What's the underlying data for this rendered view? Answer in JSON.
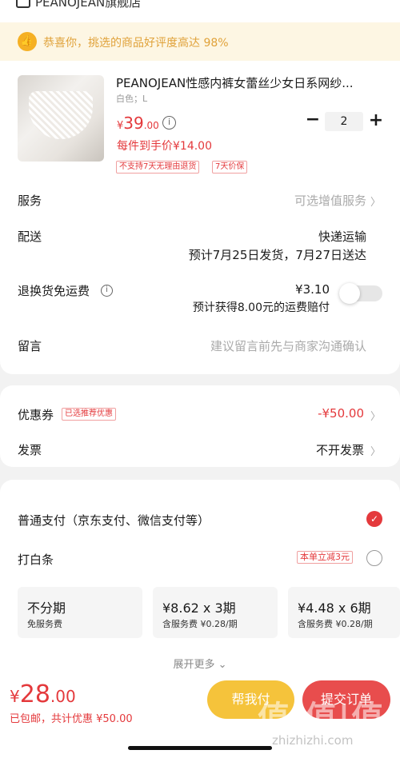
{
  "store": {
    "name": "PEANOJEAN旗舰店",
    "icon": "store-icon"
  },
  "notice": {
    "text": "恭喜你，挑选的商品好评度高达 98%",
    "icon": "thumbs-up-icon"
  },
  "product": {
    "name": "PEANOJEAN性感内裤女蕾丝少女日系网纱...",
    "spec": "白色；L",
    "price_currency": "¥",
    "price_int": "39",
    "price_dec": ".00",
    "unit_price": "每件到手价¥14.00",
    "tags": [
      "不支持7天无理由退货",
      "7天价保"
    ],
    "quantity": "2",
    "minus": "−",
    "plus": "+"
  },
  "service": {
    "label": "服务",
    "value": "可选增值服务",
    "chevron": "〉"
  },
  "delivery": {
    "label": "配送",
    "method": "快递运输",
    "schedule": "预计7月25日发货，7月27日送达"
  },
  "return_shipping": {
    "label": "退换货免运费",
    "price": "¥3.10",
    "note": "预计获得8.00元的运费赔付",
    "enabled": false
  },
  "message": {
    "label": "留言",
    "placeholder": "建议留言前先与商家沟通确认"
  },
  "coupon": {
    "label": "优惠券",
    "tag": "已选推荐优惠",
    "value": "-¥50.00",
    "chevron": "〉"
  },
  "invoice": {
    "label": "发票",
    "value": "不开发票",
    "chevron": "〉"
  },
  "payment": {
    "normal_label": "普通支付（京东支付、微信支付等）",
    "normal_selected": true,
    "baitiao_label": "打白条",
    "baitiao_tag": "本单立减3元",
    "plans": [
      {
        "title": "不分期",
        "sub": "免服务费"
      },
      {
        "title": "¥8.62 x 3期",
        "sub": "含服务费 ¥0.28/期"
      },
      {
        "title": "¥4.48 x 6期",
        "sub": "含服务费 ¥0.28/期"
      }
    ],
    "more": "展开更多 ⌄"
  },
  "footer": {
    "currency": "¥",
    "total_int": "28",
    "total_dec": ".00",
    "sub": "已包邮，共计优惠 ¥50.00",
    "help_button": "帮我付",
    "submit_button": "提交订单"
  },
  "watermark": {
    "text": "值|值|值",
    "site": "zhizhizhi.com"
  }
}
